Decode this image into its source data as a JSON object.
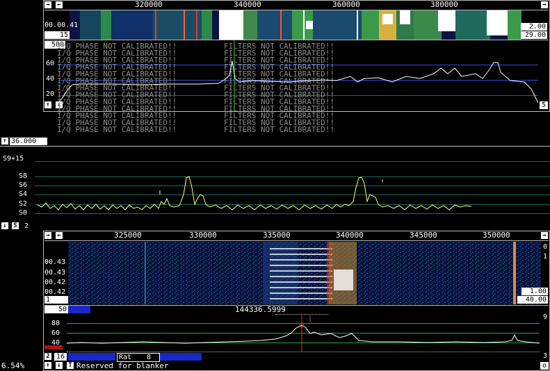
{
  "colors": {
    "accent": "#ffff80",
    "grid_blue": "#2f4fd8",
    "grid_green": "#1fae3a",
    "waterfall_bg": "#0b1440"
  },
  "wide": {
    "freq_ticks": [
      "320000",
      "340000",
      "360000",
      "380000"
    ],
    "time_label": "00.00.41",
    "avgnum": "15",
    "zoom_val": "2.00",
    "gain_val": "29.00",
    "spec_top": "500",
    "spec_y_ticks": [
      "60",
      "40",
      "20"
    ],
    "spec_right_btn": "5",
    "warn_phase": "I/Q PHASE NOT CALIBRATED!!",
    "warn_filters": "FILTERS NOT CALIBRATED!!"
  },
  "smeter": {
    "value": "36.000",
    "labels": [
      "S9+15",
      "S8",
      "S6",
      "S4",
      "S2",
      "S0"
    ],
    "bottom_num": "2",
    "s_btn": "S"
  },
  "base": {
    "freq_ticks": [
      "325000",
      "330000",
      "335000",
      "340000",
      "345000",
      "350000"
    ],
    "time_labels": [
      "00.43",
      "00.43",
      "00.42",
      "00.42"
    ],
    "bottom_left": "1",
    "right_ticks": [
      "0",
      "1"
    ],
    "zoom_val": "1.00",
    "gain_val": "40.00",
    "avg": "50",
    "freq_readout": "144336.5999",
    "y_ticks": [
      "80",
      "60",
      "40"
    ],
    "right_top": "9",
    "right_bot": "3",
    "btn_2": "2",
    "btn_16": "16",
    "rat_label": "Rat",
    "rat_val": "8",
    "btn_o": "o",
    "status": "Reserved for blanker",
    "cpu": "6.54%"
  }
}
